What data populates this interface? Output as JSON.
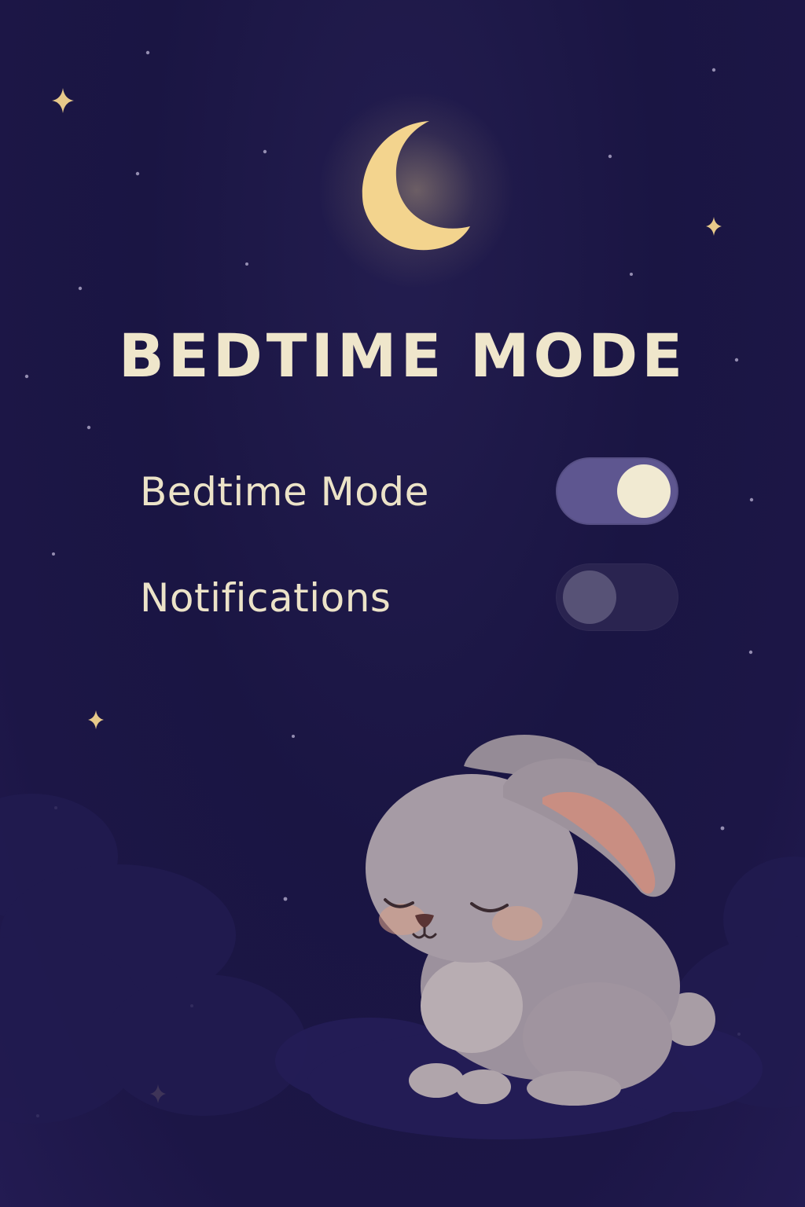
{
  "screen": {
    "title": "BEDTIME MODE"
  },
  "settings": [
    {
      "label": "Bedtime Mode",
      "enabled": true
    },
    {
      "label": "Notifications",
      "enabled": false
    }
  ],
  "colors": {
    "background": "#1b1645",
    "accent_text": "#efe6cb",
    "toggle_on_track": "#5e5690",
    "toggle_on_knob": "#f1ead2",
    "toggle_off_track": "#2a2450",
    "toggle_off_knob": "#575276",
    "moon": "#f3d48e"
  },
  "decorations": {
    "moon_icon": "crescent-moon-icon",
    "star_icon": "sparkle-star-icon",
    "mascot": "sleeping-bunny-illustration"
  }
}
